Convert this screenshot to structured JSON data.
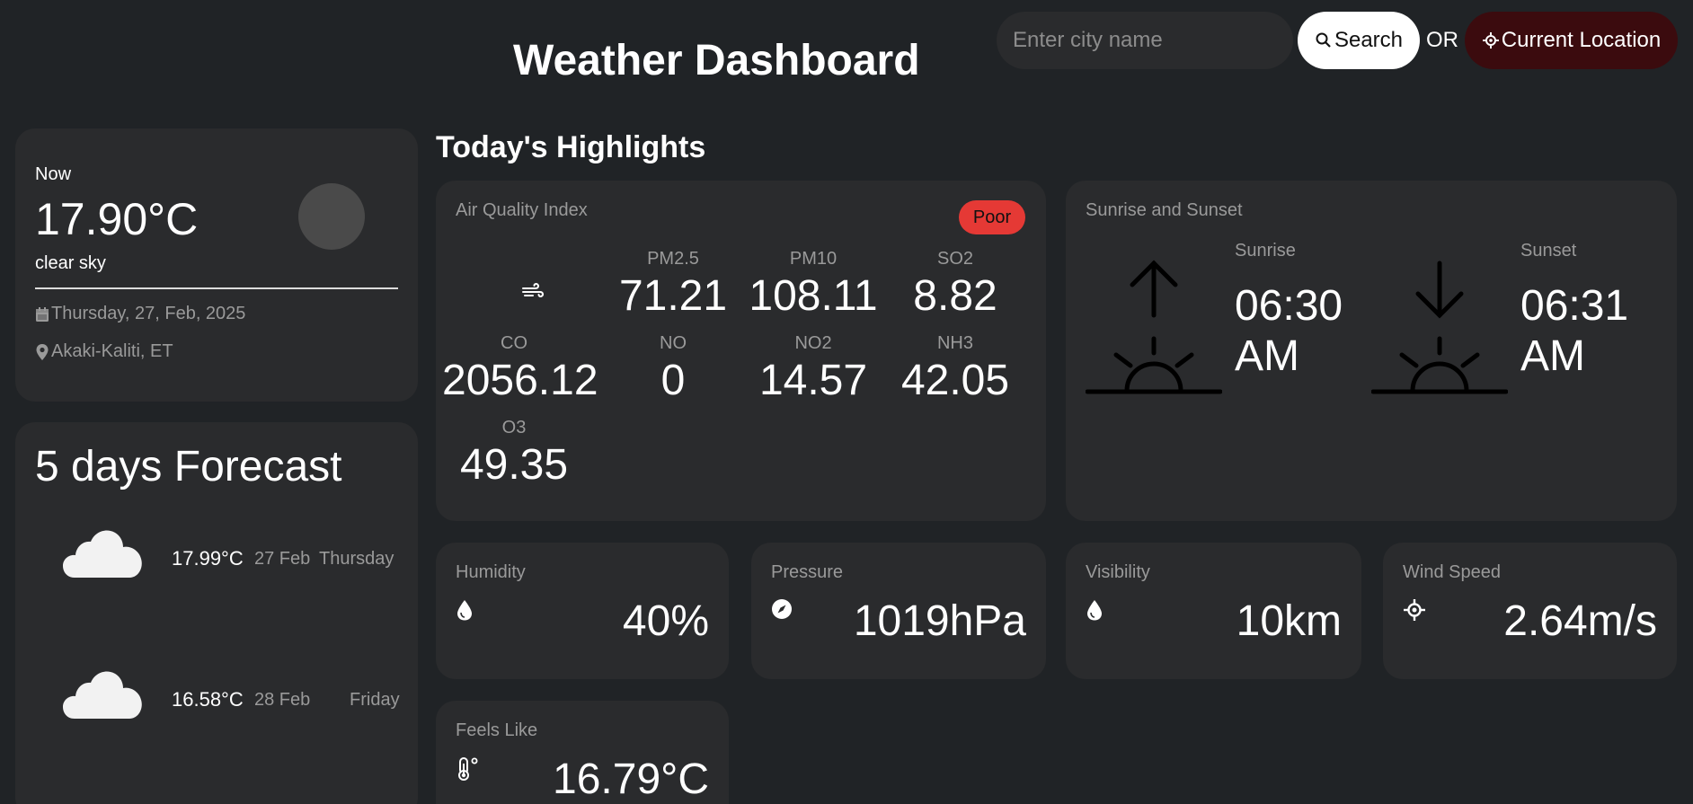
{
  "header": {
    "title": "Weather Dashboard",
    "search_placeholder": "Enter city name",
    "search_label": "Search",
    "or_label": "OR",
    "location_label": "Current Location"
  },
  "current": {
    "label": "Now",
    "temp": "17.90°C",
    "description": "clear sky",
    "date": "Thursday, 27, Feb, 2025",
    "location": "Akaki-Kaliti, ET"
  },
  "forecast": {
    "title": "5 days Forecast",
    "items": [
      {
        "temp": "17.99°C",
        "date": "27 Feb",
        "day": "Thursday",
        "icon": "cloud-icon"
      },
      {
        "temp": "16.58°C",
        "date": "28 Feb",
        "day": "Friday",
        "icon": "cloud-icon"
      }
    ]
  },
  "highlights": {
    "title": "Today's Highlights",
    "aqi": {
      "label": "Air Quality Index",
      "status": "Poor",
      "status_color": "#e53935",
      "items": [
        {
          "key": "PM2.5",
          "value": "71.21"
        },
        {
          "key": "PM10",
          "value": "108.11"
        },
        {
          "key": "SO2",
          "value": "8.82"
        },
        {
          "key": "CO",
          "value": "2056.12"
        },
        {
          "key": "NO",
          "value": "0"
        },
        {
          "key": "NO2",
          "value": "14.57"
        },
        {
          "key": "NH3",
          "value": "42.05"
        },
        {
          "key": "O3",
          "value": "49.35"
        }
      ]
    },
    "sun": {
      "label": "Sunrise and Sunset",
      "sunrise_label": "Sunrise",
      "sunrise_time": "06:30 AM",
      "sunset_label": "Sunset",
      "sunset_time": "06:31 AM"
    },
    "humidity": {
      "label": "Humidity",
      "value": "40%"
    },
    "pressure": {
      "label": "Pressure",
      "value": "1019hPa"
    },
    "visibility": {
      "label": "Visibility",
      "value": "10km"
    },
    "wind": {
      "label": "Wind Speed",
      "value": "2.64m/s"
    },
    "feels_like": {
      "label": "Feels Like",
      "value": "16.79°C"
    }
  }
}
